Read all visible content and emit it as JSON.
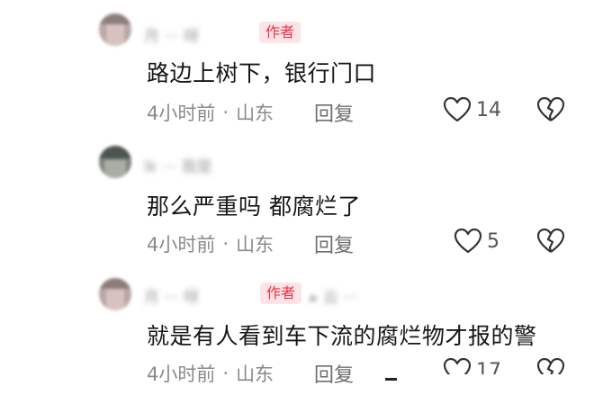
{
  "comments": [
    {
      "username": "月 ··· 呀",
      "author_badge": "作者",
      "text": "路边上树下，银行门口",
      "time": "4小时前",
      "separator": "·",
      "location": "山东",
      "reply_label": "回复",
      "like_count": "14"
    },
    {
      "username": "lk ··· 我是",
      "text": "那么严重吗  都腐烂了",
      "time": "4小时前",
      "separator": "·",
      "location": "山东",
      "reply_label": "回复",
      "like_count": "5"
    },
    {
      "username": "月 ··· 呀",
      "author_badge": "作者",
      "extra": "▸ 云 ···",
      "text": "就是有人看到车下流的腐烂物才报的警",
      "time": "4小时前",
      "separator": "·",
      "location": "山东",
      "reply_label": "回复",
      "like_count": "17"
    }
  ],
  "colors": {
    "badge_bg": "#fde4e6",
    "badge_text": "#ee2f44",
    "meta": "#8a8a8a",
    "icon": "#333333"
  }
}
